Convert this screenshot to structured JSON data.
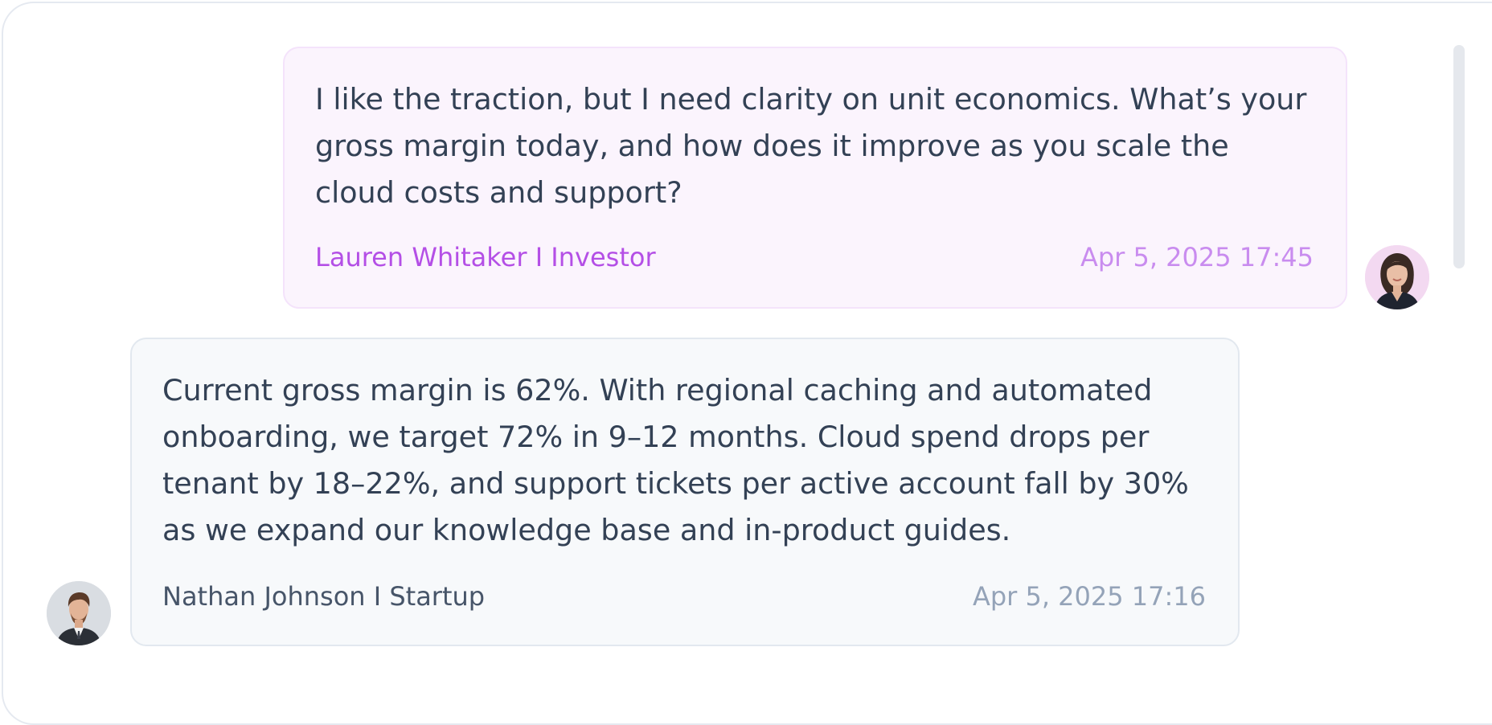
{
  "messages": [
    {
      "text": "I like the traction, but I need clarity on unit economics. What’s your gross margin today, and how does it improve as you scale the cloud costs and support?",
      "author": "Lauren Whitaker I Investor",
      "timestamp": "Apr 5, 2025 17:45",
      "side": "right",
      "accent_color": "#b44fe6",
      "bubble_color": "#fbf4fd"
    },
    {
      "text": "Current gross margin is 62%. With regional caching and automated onboarding, we target 72% in 9–12 months. Cloud spend drops per tenant by 18–22%, and support tickets per active account fall by 30% as we expand our knowledge base and in-product guides.",
      "author": "Nathan Johnson I Startup",
      "timestamp": "Apr 5, 2025 17:16",
      "side": "left",
      "accent_color": "#475569",
      "bubble_color": "#f7f9fb"
    }
  ]
}
